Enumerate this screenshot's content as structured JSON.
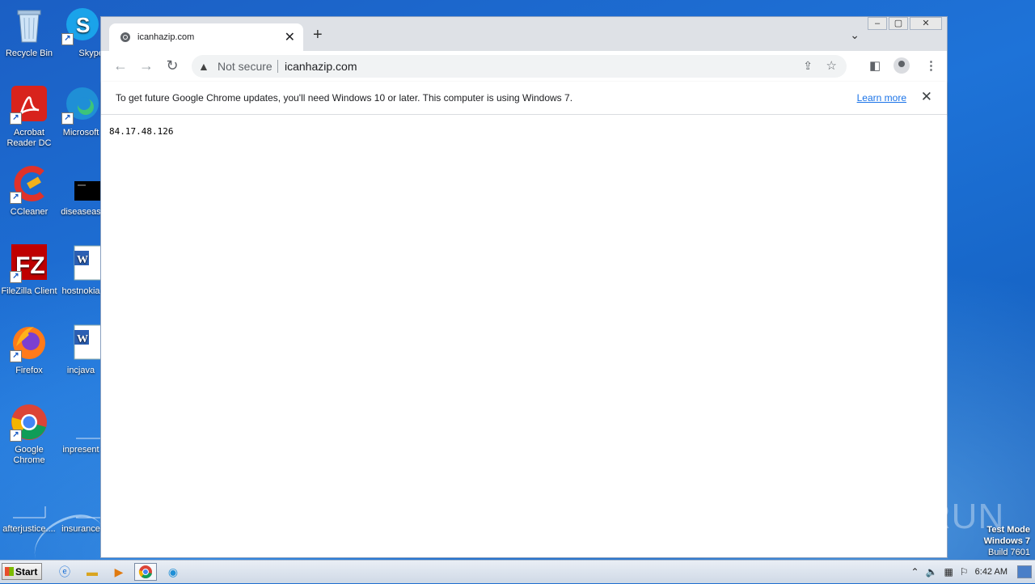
{
  "desktop": {
    "icons": [
      {
        "label": "Recycle Bin",
        "icon": "recycle-bin-icon"
      },
      {
        "label": "Skype",
        "icon": "skype-icon"
      },
      {
        "label": "Acrobat Reader DC",
        "icon": "acrobat-icon"
      },
      {
        "label": "Microsoft",
        "icon": "edge-icon"
      },
      {
        "label": "CCleaner",
        "icon": "ccleaner-icon"
      },
      {
        "label": "diseaseas",
        "icon": "file-icon"
      },
      {
        "label": "FileZilla Client",
        "icon": "filezilla-icon"
      },
      {
        "label": "hostnokia",
        "icon": "word-doc-icon"
      },
      {
        "label": "Firefox",
        "icon": "firefox-icon"
      },
      {
        "label": "incjava",
        "icon": "word-doc-icon"
      },
      {
        "label": "Google Chrome",
        "icon": "chrome-icon"
      },
      {
        "label": "inpresent",
        "icon": "file-icon"
      },
      {
        "label": "afterjustice....",
        "icon": "file-icon"
      },
      {
        "label": "insurance",
        "icon": "file-icon"
      }
    ],
    "watermark": "ANY RUN",
    "test_mode": {
      "line1": "Test Mode",
      "line2": "Windows 7",
      "line3": "Build 7601"
    }
  },
  "browser": {
    "tab": {
      "title": "icanhazip.com"
    },
    "omnibox": {
      "security": "Not secure",
      "url": "icanhazip.com"
    },
    "infobar": {
      "message": "To get future Google Chrome updates, you'll need Windows 10 or later. This computer is using Windows 7.",
      "link": "Learn more"
    },
    "page": {
      "text": "84.17.48.126"
    }
  },
  "taskbar": {
    "start_label": "Start",
    "clock": "6:42 AM"
  }
}
